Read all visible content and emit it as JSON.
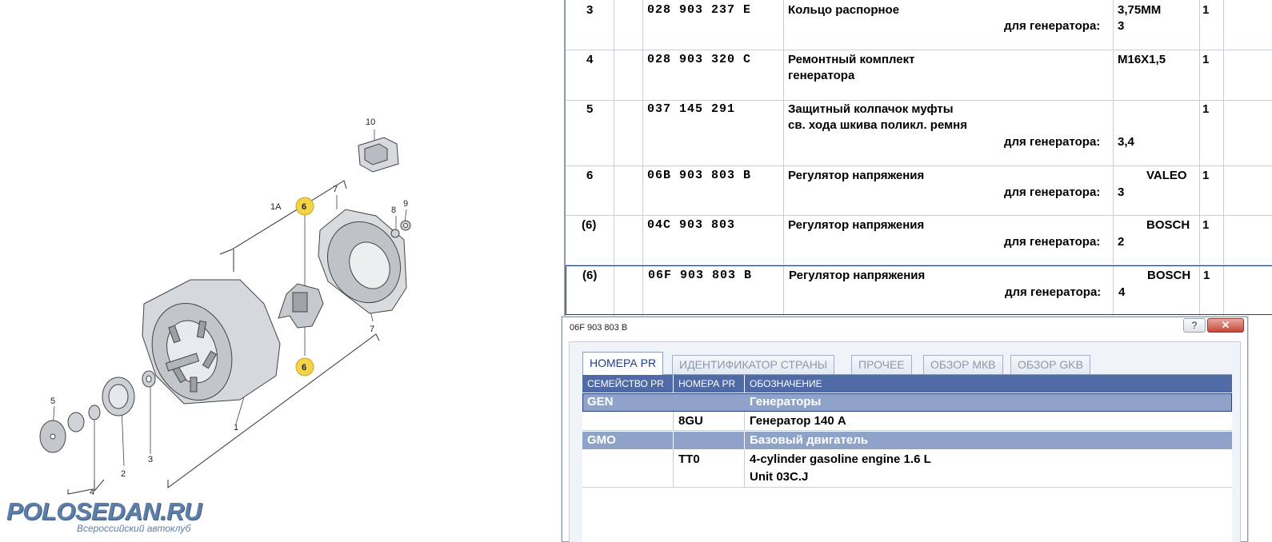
{
  "diagram": {
    "callouts": [
      "10",
      "1A",
      "7",
      "8",
      "9",
      "6",
      "6",
      "7",
      "5",
      "1",
      "2",
      "3",
      "4"
    ],
    "logo_brand": "POLOSEDAN.RU",
    "logo_tagline": "Всероссийский автоклуб"
  },
  "parts": {
    "rows": [
      {
        "pos": "3",
        "part_no": "028 903 237 E",
        "name": "Кольцо распорное",
        "note_label": "для генератора:",
        "spec": "3,75ММ",
        "note_value": "3",
        "supplier": "",
        "qty": "1"
      },
      {
        "pos": "4",
        "part_no": "028 903 320 C",
        "name": "Ремонтный комплект",
        "name2": "генератора",
        "note_label": "",
        "spec": "M16X1,5",
        "note_value": "",
        "supplier": "",
        "qty": "1"
      },
      {
        "pos": "5",
        "part_no": "037 145 291",
        "name": "Защитный колпачок муфты",
        "name2": "св. хода шкива поликл. ремня",
        "note_label": "для генератора:",
        "spec": "",
        "note_value": "3,4",
        "supplier": "",
        "qty": "1"
      },
      {
        "pos": "6",
        "part_no": "06B 903 803 B",
        "name": "Регулятор напряжения",
        "note_label": "для генератора:",
        "spec": "",
        "note_value": "3",
        "supplier": "VALEO",
        "qty": "1"
      },
      {
        "pos": "(6)",
        "part_no": "04C 903 803",
        "name": "Регулятор напряжения",
        "note_label": "для генератора:",
        "spec": "",
        "note_value": "2",
        "supplier": "BOSCH",
        "qty": "1"
      },
      {
        "pos": "(6)",
        "part_no": "06F 903 803 B",
        "name": "Регулятор напряжения",
        "note_label": "для генератора:",
        "spec": "",
        "note_value": "4",
        "supplier": "BOSCH",
        "qty": "1"
      }
    ]
  },
  "popup": {
    "title": "06F 903 803 B",
    "help_label": "?",
    "close_label": "✕",
    "tabs": [
      "НОМЕРА PR",
      "ИДЕНТИФИКАТОР СТРАНЫ",
      "ПРОЧЕЕ",
      "ОБЗОР МКВ",
      "ОБЗОР GKB"
    ],
    "active_tab": 0,
    "columns": [
      "СЕМЕЙСТВО PR",
      "НОМЕРА PR",
      "ОБОЗНАЧЕНИЕ"
    ],
    "rows": [
      {
        "family": "GEN",
        "pr": "",
        "designation": "Генераторы",
        "group": true
      },
      {
        "family": "",
        "pr": "8GU",
        "designation": "Генератор 140 А",
        "group": false
      },
      {
        "family": "GMO",
        "pr": "",
        "designation": "Базовый двигатель",
        "group": true
      },
      {
        "family": "",
        "pr": "TT0",
        "designation": "4-cylinder gasoline engine 1.6 L",
        "designation2": "Unit 03C.J",
        "group": false
      }
    ]
  },
  "colors": {
    "badge": "#f2d34a",
    "grid_header": "#4f6aa5",
    "group_row": "#8fa3c9",
    "tab_active_text": "#1f3c86"
  }
}
